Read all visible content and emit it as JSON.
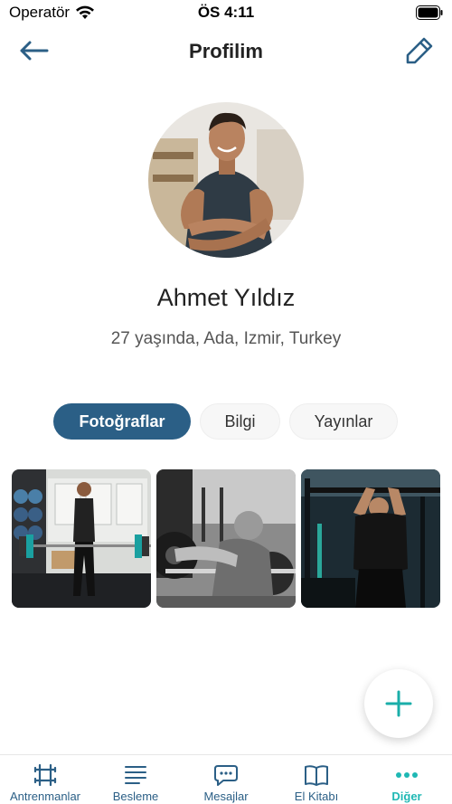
{
  "status_bar": {
    "carrier": "Operatör",
    "time": "ÖS 4:11"
  },
  "nav": {
    "title": "Profilim",
    "back_icon": "arrow-left-icon",
    "edit_icon": "pencil-icon"
  },
  "profile": {
    "name": "Ahmet Yıldız",
    "subtitle": "27 yaşında, Ada, Izmir, Turkey"
  },
  "tabs": [
    {
      "label": "Fotoğraflar",
      "active": true
    },
    {
      "label": "Bilgi",
      "active": false
    },
    {
      "label": "Yayınlar",
      "active": false
    }
  ],
  "fab": {
    "icon": "plus-icon"
  },
  "tab_bar": [
    {
      "label": "Antrenmanlar",
      "icon": "dumbbell-icon"
    },
    {
      "label": "Besleme",
      "icon": "list-icon"
    },
    {
      "label": "Mesajlar",
      "icon": "chat-bubble-icon"
    },
    {
      "label": "El Kitabı",
      "icon": "book-icon"
    },
    {
      "label": "Diğer",
      "icon": "more-dots-icon",
      "active": true
    }
  ],
  "colors": {
    "primary": "#2b5f86",
    "accent": "#1fb8b4",
    "fab_plus": "#1aaea9"
  }
}
